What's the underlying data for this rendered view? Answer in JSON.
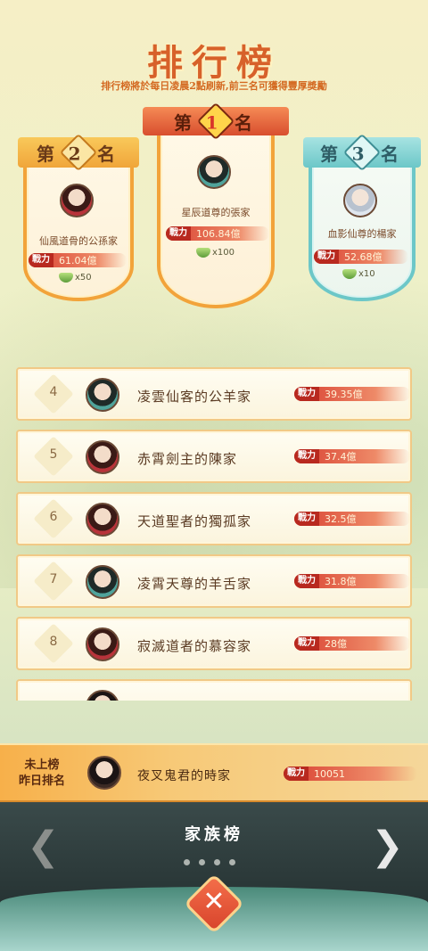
{
  "title": "排行榜",
  "subtitle": "排行榜將於每日凌晨2點刷新,前三名可獲得豐厚獎勵",
  "power_label": "戰力",
  "rank_prefix": "第",
  "rank_suffix": "名",
  "top3": [
    {
      "rank": "1",
      "name": "星辰道尊的張家",
      "power": "106.84億",
      "reward": "x100"
    },
    {
      "rank": "2",
      "name": "仙風道骨的公孫家",
      "power": "61.04億",
      "reward": "x50"
    },
    {
      "rank": "3",
      "name": "血影仙尊的楊家",
      "power": "52.68億",
      "reward": "x10"
    }
  ],
  "list": [
    {
      "rank": "4",
      "name": "凌雲仙客的公羊家",
      "power": "39.35億"
    },
    {
      "rank": "5",
      "name": "赤霄劍主的陳家",
      "power": "37.4億"
    },
    {
      "rank": "6",
      "name": "天道聖者的獨孤家",
      "power": "32.5億"
    },
    {
      "rank": "7",
      "name": "凌霄天尊的羊舌家",
      "power": "31.8億"
    },
    {
      "rank": "8",
      "name": "寂滅道者的慕容家",
      "power": "28億"
    }
  ],
  "self": {
    "rank_label_line1": "未上榜",
    "rank_label_line2": "昨日排名",
    "name": "夜叉鬼君的時家",
    "power": "10051"
  },
  "footer": {
    "tab_title": "家族榜",
    "left_arrow": "❮",
    "right_arrow": "❯",
    "close": "✕"
  },
  "colors": {
    "accent": "#d7612a",
    "gold_border": "#f2a33a",
    "teal_border": "#6cc7c8",
    "power_red": "#d84031"
  }
}
